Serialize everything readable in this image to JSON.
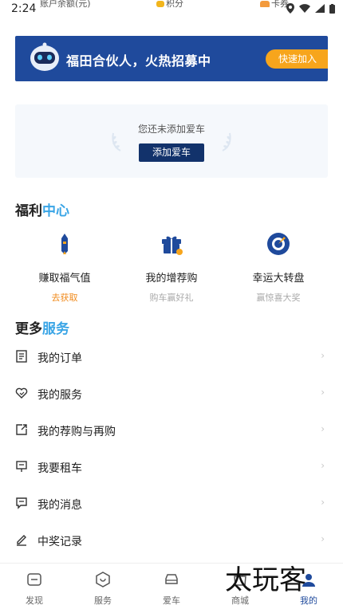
{
  "status_bar": {
    "time": "2:24",
    "cut_texts": [
      "账户余额(元)",
      "积分",
      "卡券"
    ]
  },
  "banner": {
    "title": "福田合伙人，火热招募中",
    "button": "快速加入"
  },
  "car": {
    "empty_text": "您还未添加爱车",
    "add_button": "添加爱车"
  },
  "welfare": {
    "title_main": "福利",
    "title_highlight": "中心",
    "items": [
      {
        "name": "赚取福气值",
        "sub": "去获取"
      },
      {
        "name": "我的增荐购",
        "sub": "购车赢好礼"
      },
      {
        "name": "幸运大转盘",
        "sub": "赢惊喜大奖"
      }
    ]
  },
  "services": {
    "title_main": "更多",
    "title_highlight": "服务",
    "items": [
      {
        "label": "我的订单"
      },
      {
        "label": "我的服务"
      },
      {
        "label": "我的荐购与再购"
      },
      {
        "label": "我要租车"
      },
      {
        "label": "我的消息"
      },
      {
        "label": "中奖记录"
      }
    ],
    "chevron": "›"
  },
  "bottom_nav": {
    "items": [
      {
        "label": "发现"
      },
      {
        "label": "服务"
      },
      {
        "label": "爱车"
      },
      {
        "label": "商城"
      },
      {
        "label": "我的"
      }
    ],
    "active": "我的"
  },
  "watermark": "太玩客",
  "colors": {
    "brand_blue": "#1f4a9c",
    "accent_orange": "#f7a51c",
    "highlight_blue": "#3aa5e6"
  }
}
